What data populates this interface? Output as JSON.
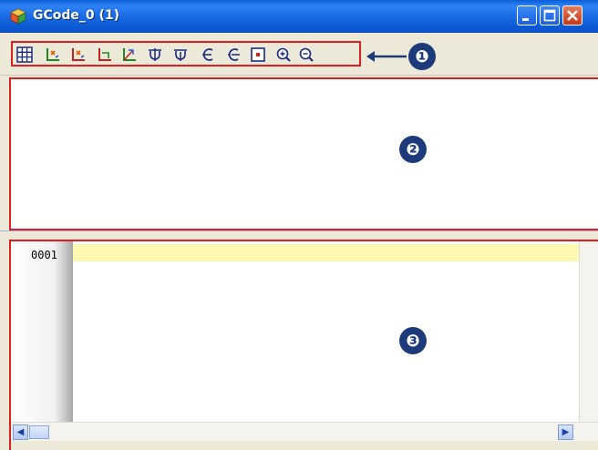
{
  "window": {
    "title": "GCode_0 (1)",
    "minimize_icon": "minimize-icon",
    "maximize_icon": "maximize-icon",
    "close_icon": "close-icon"
  },
  "toolbar": {
    "buttons": [
      {
        "icon": "grid-icon"
      },
      {
        "icon": "axis-xy-icon"
      },
      {
        "icon": "axis-xz-icon"
      },
      {
        "icon": "axis-yz-icon"
      },
      {
        "icon": "axis-3d-icon"
      },
      {
        "icon": "flip-vertical-icon"
      },
      {
        "icon": "flip-vertical-alt-icon"
      },
      {
        "icon": "rotate-left-icon"
      },
      {
        "icon": "rotate-right-icon"
      },
      {
        "icon": "fit-view-icon"
      },
      {
        "icon": "zoom-in-icon"
      },
      {
        "icon": "zoom-out-icon"
      }
    ]
  },
  "callouts": [
    "❶",
    "❷",
    "❸"
  ],
  "editor": {
    "lines": [
      {
        "number": "0001",
        "text": ""
      }
    ]
  },
  "colors": {
    "title_bar": "#0a5fd8",
    "highlight_box": "#e02020",
    "current_line": "#fdf9b0",
    "callout": "#1d3a7a"
  }
}
